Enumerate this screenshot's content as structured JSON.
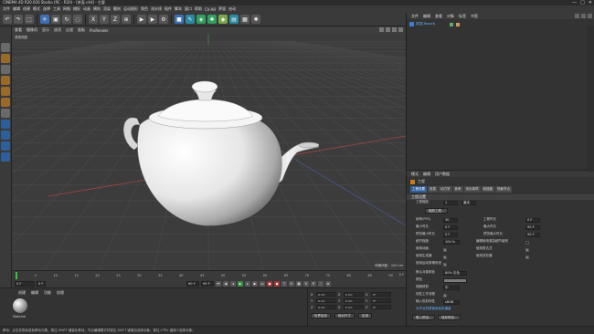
{
  "window": {
    "title": "CINEMA 4D R20.026 Studio (RC - R20) - [茶壶.c4d] - 主要",
    "controls": [
      "—",
      "□",
      "✕"
    ]
  },
  "menu": [
    "文件",
    "编辑",
    "创建",
    "模式",
    "选择",
    "工具",
    "网格",
    "捕捉",
    "动画",
    "模拟",
    "渲染",
    "雕刻",
    "运动图形",
    "角色",
    "流水线",
    "插件",
    "脚本",
    "窗口",
    "帮助",
    "CV-AR",
    "界面",
    "启动"
  ],
  "toolbar": {
    "icons": [
      {
        "name": "undo",
        "glyph": "↶",
        "color": "gray"
      },
      {
        "name": "redo",
        "glyph": "↷",
        "color": "gray"
      },
      {
        "name": "select",
        "glyph": "⬚",
        "color": "gray"
      },
      {
        "name": "move",
        "glyph": "✛",
        "color": "blue"
      },
      {
        "name": "scale",
        "glyph": "▣",
        "color": "gray"
      },
      {
        "name": "rotate",
        "glyph": "↻",
        "color": "gray"
      },
      {
        "name": "live-select",
        "glyph": "◌",
        "color": "gray"
      },
      {
        "name": "axis-x",
        "glyph": "X",
        "color": "gray"
      },
      {
        "name": "axis-y",
        "glyph": "Y",
        "color": "gray"
      },
      {
        "name": "axis-z",
        "glyph": "Z",
        "color": "gray"
      },
      {
        "name": "coord-system",
        "glyph": "⊕",
        "color": "gray"
      },
      {
        "name": "render-view",
        "glyph": "▶",
        "color": "gray"
      },
      {
        "name": "render",
        "glyph": "▶",
        "color": "gray"
      },
      {
        "name": "render-settings",
        "glyph": "⚙",
        "color": "gray"
      },
      {
        "name": "cube",
        "glyph": "■",
        "color": "blue"
      },
      {
        "name": "pen",
        "glyph": "✎",
        "color": "teal"
      },
      {
        "name": "subdivision",
        "glyph": "◈",
        "color": "green"
      },
      {
        "name": "array",
        "glyph": "✱",
        "color": "green"
      },
      {
        "name": "deformer",
        "glyph": "◆",
        "color": "sel"
      },
      {
        "name": "scene",
        "glyph": "▤",
        "color": "teal"
      },
      {
        "name": "camera",
        "glyph": "▦",
        "color": "gray"
      },
      {
        "name": "light",
        "glyph": "✺",
        "color": "gray"
      }
    ]
  },
  "viewport": {
    "menu": [
      "查看",
      "摄像机",
      "显示",
      "选项",
      "过滤",
      "面板",
      "ProRender"
    ],
    "label": "透视视图",
    "grid_info": "网格间距：100 cm"
  },
  "timeline": {
    "ticks": [
      "0",
      "5",
      "10",
      "15",
      "20",
      "25",
      "30",
      "35",
      "40",
      "45",
      "50",
      "55",
      "60",
      "65",
      "70",
      "75",
      "80",
      "85",
      "90"
    ],
    "end": "0 F"
  },
  "transport": {
    "start": "0 F",
    "current": "0 F",
    "end": "90 F",
    "end2": "90 F"
  },
  "materials": {
    "menu": [
      "创建",
      "编辑",
      "功能",
      "纹理"
    ],
    "name": "Material"
  },
  "coordinates": {
    "rows": [
      {
        "axis": "X",
        "a": "0 cm",
        "b": "0 cm",
        "c": "0°"
      },
      {
        "axis": "Y",
        "a": "0 cm",
        "b": "0 cm",
        "c": "0°"
      },
      {
        "axis": "Z",
        "a": "0 cm",
        "b": "0 cm",
        "c": "0°"
      }
    ],
    "mode1": "世界坐标",
    "mode2": "绝对尺寸",
    "apply": "应用"
  },
  "objects": {
    "tabs": [
      "文件",
      "编辑",
      "查看",
      "对象",
      "标签",
      "书签"
    ],
    "items": [
      {
        "name": "茶壶(Teapot)"
      }
    ]
  },
  "attributes": {
    "tabs_header": [
      "模式",
      "编辑",
      "用户数据"
    ],
    "title": "工程",
    "tabs": [
      "工程设置",
      "信息",
      "动力学",
      "参考",
      "待办事项",
      "帧插值",
      "场景节点"
    ],
    "section": "工程设置",
    "scale_label": "工程缩放",
    "scale_value": "1",
    "scale_unit": "厘米",
    "scale_button": "缩放工程...",
    "fps_label": "帧率(FPS)",
    "fps_value": "30",
    "time_label": "工程时长",
    "time_value": "0 F",
    "min_label": "最小时长",
    "min_value": "0 F",
    "max_label": "最大时长",
    "max_value": "90 F",
    "pmin_label": "预览最小时长",
    "pmin_value": "0 F",
    "pmax_label": "预览最大时长",
    "pmax_value": "90 F",
    "lod_label": "细节程度",
    "lod_value": "100 %",
    "lod_check_label": "编辑使用渲染细节级别",
    "use_anim": "使用动画",
    "use_expr": "使用表达式",
    "use_gen": "使用生成器",
    "use_deform": "使用变形器",
    "use_motion": "使用运动剪辑系统",
    "default_color_label": "默认对象颜色",
    "default_color_value": "80% 灰色",
    "color_label": "颜色",
    "view_clip_label": "视图修剪",
    "view_clip_value": "中",
    "linear_label": "线性工作流程",
    "input_color_label": "输入色彩特性",
    "input_color_value": "sRGB",
    "node_label": "为节点材质使用色彩通道",
    "load_btn": "载入预设...",
    "save_btn": "保存预设..."
  },
  "status": "移动：点击并拖动鼠标移动元素。按住 SHIFT 键量化移动；节点编辑模式时按住 SHIFT 键增加选择对象；按住 CTRL 键减少选择对象。"
}
